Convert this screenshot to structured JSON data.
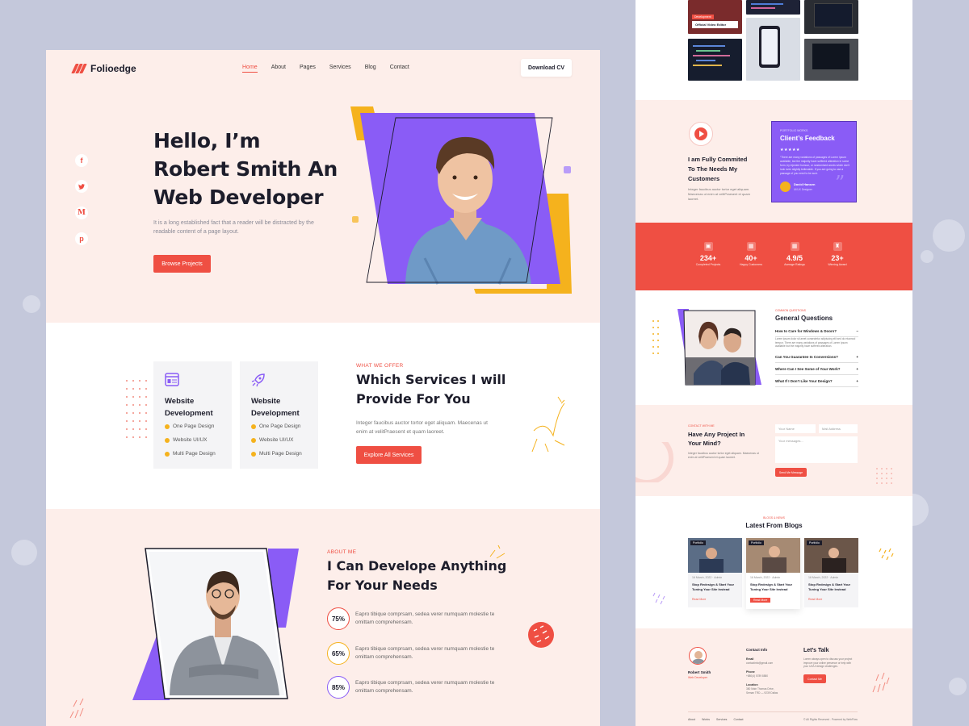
{
  "brand": {
    "name": "Folioedge",
    "accent": "#ef4f43",
    "purple": "#8a5cf6",
    "yellow": "#f5b21d"
  },
  "nav": {
    "items": [
      "Home",
      "About",
      "Pages",
      "Services",
      "Blog",
      "Contact"
    ],
    "active": "Home",
    "cta": "Download CV"
  },
  "social": [
    "f",
    "twitter-icon",
    "M",
    "p"
  ],
  "hero": {
    "title_lines": [
      "Hello, I’m",
      "Robert Smith An",
      "Web Developer"
    ],
    "subtitle": "It is a long established fact that a reader will be distracted by the readable content of a page layout.",
    "button": "Browse Projects"
  },
  "services": {
    "kicker": "WHAT WE OFFER",
    "heading_lines": [
      "Which Services I will",
      "Provide For You"
    ],
    "text": "Integer faucibus auctor tortor eget aliquam. Maecenas ut enim at velitPraesent et quam laoreet.",
    "button": "Explore All Services",
    "cards": [
      {
        "title_lines": [
          "Website",
          "Development"
        ],
        "items": [
          "One Page Design",
          "Website UI/UX",
          "Multi Page Design"
        ]
      },
      {
        "title_lines": [
          "Website",
          "Development"
        ],
        "items": [
          "One Page Design",
          "Website UI/UX",
          "Multi Page Design"
        ]
      }
    ]
  },
  "about": {
    "kicker": "ABOUT ME",
    "heading_lines": [
      "I Can Develope Anything",
      "For Your Needs"
    ],
    "skills": [
      {
        "percent": "75%",
        "text": "Eapro tibique comprsam, sedea verer numquam molestie te omittam comprehensam.",
        "color": "#ef4f43"
      },
      {
        "percent": "65%",
        "text": "Eapro tibique comprsam, sedea verer numquam molestie te omittam comprehensam.",
        "color": "#f5b21d"
      },
      {
        "percent": "85%",
        "text": "Eapro tibique comprsam, sedea verer numquam molestie te omittam comprehensam.",
        "color": "#8a5cf6"
      }
    ]
  },
  "right": {
    "portfolio": {
      "tag": "Development",
      "caption": "Official Video Editor"
    },
    "commit": {
      "heading_lines": [
        "I am Fully Commited",
        "To The Needs My",
        "Customers"
      ],
      "text": "Integer faucibus auctor tortor eget aliquam. Maecenas ut enim at velitPraesent et quam laoreet."
    },
    "feedback": {
      "kicker": "PORTFOLIO WORKS",
      "heading": "Client’s Feedback",
      "stars": "★★★★★",
      "quote": "“There are many variations of passages of Lorem Ipsum available, but the majority have suffered alteration in some form, by injected humour, or randomised words which don't look even slightly believable. If you are going to use a passage of you need to be sure.",
      "name": "David Hansen",
      "role": "UI/UX Designer"
    },
    "stats": [
      {
        "icon": "briefcase-icon",
        "num": "234+",
        "label": "Completed Projects"
      },
      {
        "icon": "gift-icon",
        "num": "40+",
        "label": "Happy Customers"
      },
      {
        "icon": "gift-icon",
        "num": "4.9/5",
        "label": "Average Ratings"
      },
      {
        "icon": "trophy-icon",
        "num": "23+",
        "label": "Winning Award"
      }
    ],
    "faq": {
      "kicker": "COMMON QUESTIONS",
      "heading": "General Questions",
      "items": [
        {
          "q": "How to Care for Windows & Doors?",
          "sign": "−",
          "answer": "Lorem ipsum dolor sit amet consectetur adipiscing elit sed do eiusmod tempor. There are many variations of passages of Lorem Ipsum available but the majority have suffered alteration."
        },
        {
          "q": "Can You Guarantee In Conversions?",
          "sign": "+"
        },
        {
          "q": "Where Can I See Some of Your Work?",
          "sign": "+"
        },
        {
          "q": "What If I Don’t Like Your Design?",
          "sign": "+"
        }
      ]
    },
    "contact": {
      "kicker": "CONTACT WITH ME",
      "heading_lines": [
        "Have Any Project In",
        "Your Mind?"
      ],
      "text": "Integer faucibus auctor tortor eget aliquam. Maecenas ut enim at velitPraesent et quam laoreet.",
      "name_ph": "Your Name",
      "email_ph": "Mail Address",
      "msg_ph": "Your messages...",
      "button": "Send Me Message"
    },
    "blogs": {
      "kicker": "BLOGS & NEWS",
      "heading": "Latest From Blogs",
      "cards": [
        {
          "tag": "Portfolio",
          "date": "16 March, 2022",
          "author": "Admin",
          "title": "Stop Redesign & Start Your Tuning Your Site Instead",
          "link": "Read More"
        },
        {
          "tag": "Portfolio",
          "date": "16 March, 2022",
          "author": "Admin",
          "title": "Stop Redesign & Start Your Tuning Your Site Instead",
          "link": "Read More"
        },
        {
          "tag": "Portfolio",
          "date": "16 March, 2022",
          "author": "Admin",
          "title": "Stop Redesign & Start Your Tuning Your Site Instead",
          "link": "Read More"
        }
      ]
    },
    "footer": {
      "name": "Robert Smith",
      "role": "Web Developer",
      "contact_heading": "Contact Info",
      "email_label": "Email",
      "email": "contactinfo@gmail.com",
      "phone_label": "Phone",
      "phone": "+880(4) 5789 8880",
      "location_label": "Location",
      "location": "380 Main Thomas Drive, Seman TRD — 9239 Dallas",
      "talk_heading": "Let’s Talk",
      "talk_text": "Lorem always open to discuss your project improve your online presence or help with your UX/UI design challenges.",
      "talk_button": "Contact Me",
      "links": [
        "About",
        "Works",
        "Services",
        "Contact"
      ],
      "copyright": "© All Rights Reserved . Powered by WebFlow"
    }
  }
}
